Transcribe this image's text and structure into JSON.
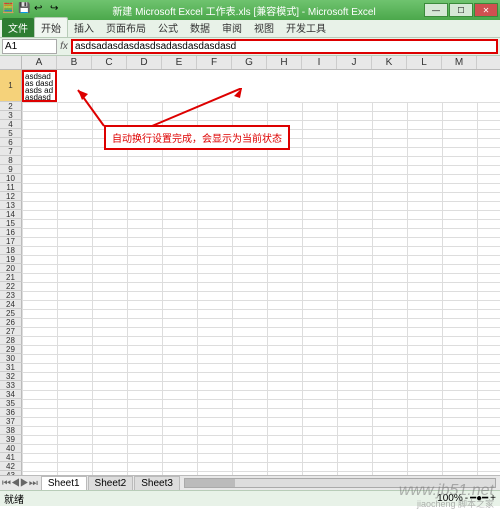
{
  "window": {
    "title": "新建 Microsoft Excel 工作表.xls [兼容模式] - Microsoft Excel",
    "min": "—",
    "max": "☐",
    "close": "✕"
  },
  "ribbon": {
    "file": "文件",
    "tabs": [
      "开始",
      "插入",
      "页面布局",
      "公式",
      "数据",
      "审阅",
      "视图",
      "开发工具"
    ]
  },
  "namebox": "A1",
  "fx": "fx",
  "formula": "asdsadasdasdasdsadasdasdasdasd",
  "cols": [
    "A",
    "B",
    "C",
    "D",
    "E",
    "F",
    "G",
    "H",
    "I",
    "J",
    "K",
    "L",
    "M",
    "N"
  ],
  "row_count": 47,
  "a1_wrapped": "asdsadas\ndasdasds\nadasdasd\nasdasd",
  "callout": "自动换行设置完成，会显示为当前状态",
  "sheets": {
    "nav": "⏮◀▶⏭",
    "tabs": [
      "Sheet1",
      "Sheet2",
      "Sheet3"
    ],
    "active": 0
  },
  "status": {
    "left": "就绪",
    "zoom": "100%",
    "minus": "-",
    "plus": "+"
  },
  "watermark": {
    "main": "www.jb51.net",
    "sub": "jiaocheng 脚本之家"
  }
}
